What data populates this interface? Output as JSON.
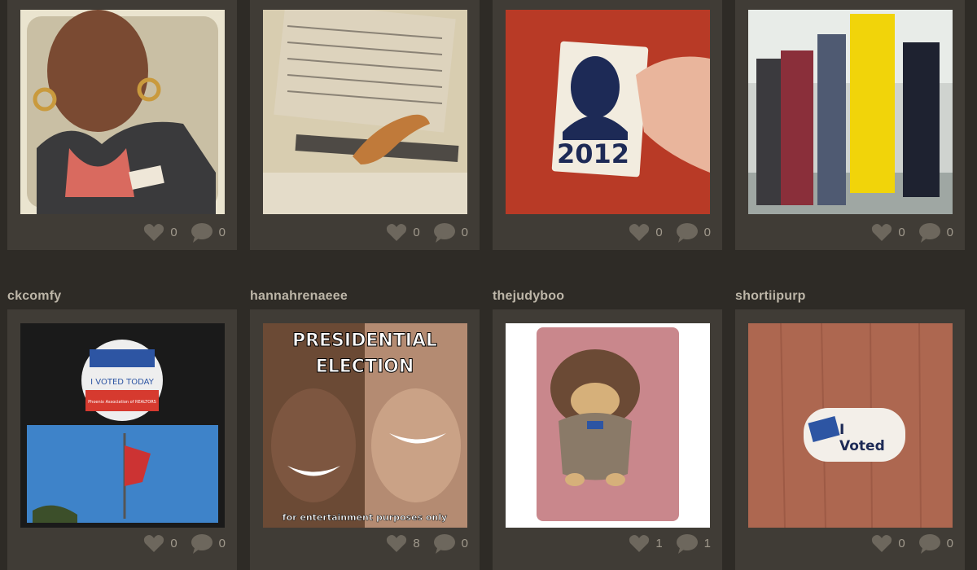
{
  "row1": [
    {
      "likes": "0",
      "comments": "0"
    },
    {
      "likes": "0",
      "comments": "0"
    },
    {
      "likes": "0",
      "comments": "0",
      "sticker_text": "2012"
    },
    {
      "likes": "0",
      "comments": "0"
    }
  ],
  "row2": [
    {
      "username": "ckcomfy",
      "likes": "0",
      "comments": "0",
      "button_text": "I VOTED TODAY",
      "button_sub": "Phoenix Association of REALTORS"
    },
    {
      "username": "hannahrenaeee",
      "likes": "8",
      "comments": "0",
      "headline_1": "PRESIDENTIAL",
      "headline_2": "ELECTION",
      "footer": "for entertainment purposes only"
    },
    {
      "username": "thejudyboo",
      "likes": "1",
      "comments": "1"
    },
    {
      "username": "shortiipurp",
      "likes": "0",
      "comments": "0",
      "sticker_line1": "I",
      "sticker_line2": "Voted"
    }
  ],
  "colors": {
    "background": "#2e2b26",
    "card": "#403c36",
    "username": "#bdb6a8",
    "stat": "#a19a8d"
  }
}
